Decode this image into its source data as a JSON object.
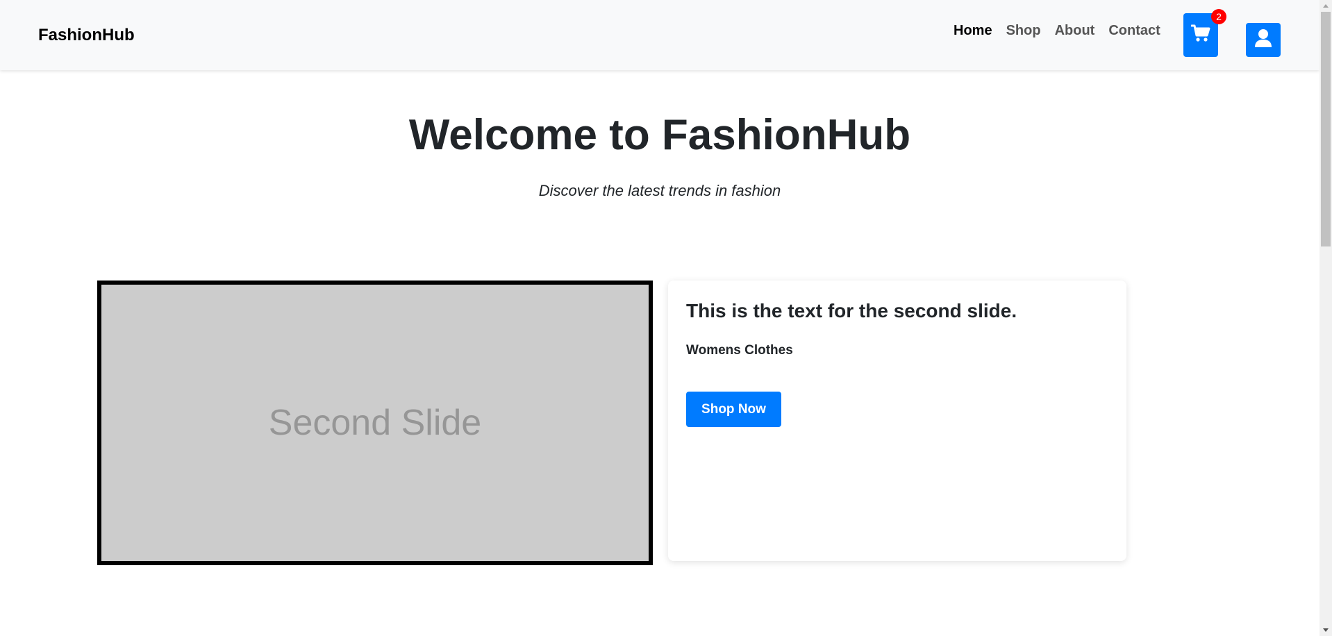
{
  "navbar": {
    "brand": "FashionHub",
    "links": [
      {
        "label": "Home",
        "active": true
      },
      {
        "label": "Shop",
        "active": false
      },
      {
        "label": "About",
        "active": false
      },
      {
        "label": "Contact",
        "active": false
      }
    ],
    "cart": {
      "icon": "shopping-cart-icon",
      "count": "2"
    },
    "user": {
      "icon": "user-icon"
    }
  },
  "hero": {
    "title": "Welcome to FashionHub",
    "subtitle": "Discover the latest trends in fashion"
  },
  "carousel": {
    "slide_placeholder": "Second Slide",
    "caption_title": "This is the text for the second slide.",
    "caption_category": "Womens Clothes",
    "cta_label": "Shop Now"
  },
  "colors": {
    "primary": "#007bff",
    "badge": "#ff0000",
    "navbar_bg": "#f8f9fa",
    "slide_bg": "#cccccc",
    "text": "#212529"
  }
}
